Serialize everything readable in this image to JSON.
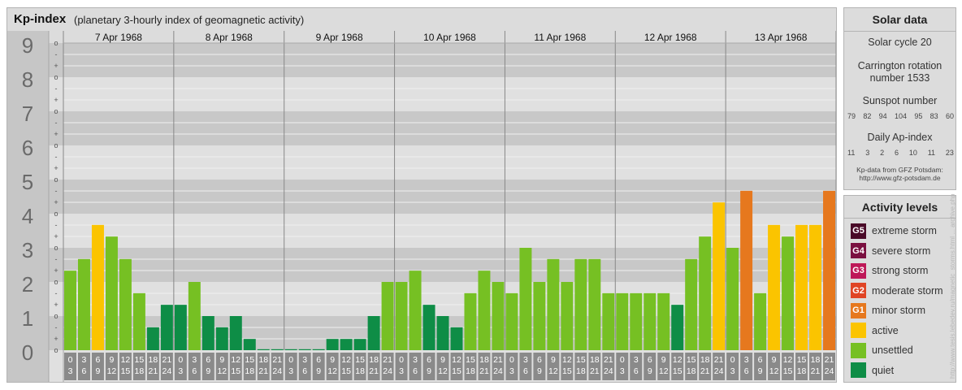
{
  "title": {
    "main": "Kp-index",
    "sub": "(planetary 3-hourly index of geomagnetic activity)"
  },
  "colors": {
    "quiet": "#0e8d46",
    "unsettled": "#76c023",
    "active": "#fbc400",
    "minor_storm": "#e6781e",
    "moderate_storm": "#e04424",
    "strong_storm": "#be1858",
    "severe_storm": "#7a1040",
    "extreme_storm": "#4a0a28"
  },
  "chart_data": {
    "type": "bar",
    "title": "Kp-index",
    "subtitle": "(planetary 3-hourly index of geomagnetic activity)",
    "y_axis_labels": [
      "0",
      "1",
      "2",
      "3",
      "4",
      "5",
      "6",
      "7",
      "8",
      "9"
    ],
    "y_minor_labels": [
      "o",
      "+",
      "-"
    ],
    "ylim": [
      0,
      9
    ],
    "days": [
      "7 Apr 1968",
      "8 Apr 1968",
      "9 Apr 1968",
      "10 Apr 1968",
      "11 Apr 1968",
      "12 Apr 1968",
      "13 Apr 1968"
    ],
    "interval_top": [
      "0",
      "3",
      "6",
      "9",
      "12",
      "15",
      "18",
      "21"
    ],
    "interval_bottom": [
      "3",
      "6",
      "9",
      "12",
      "15",
      "18",
      "21",
      "24"
    ],
    "values": [
      2.33,
      2.67,
      3.67,
      3.33,
      2.67,
      1.67,
      0.67,
      1.33,
      1.33,
      2.0,
      1.0,
      0.67,
      1.0,
      0.33,
      0.0,
      0.0,
      0.0,
      0.0,
      0.0,
      0.33,
      0.33,
      0.33,
      1.0,
      2.0,
      2.0,
      2.33,
      1.33,
      1.0,
      0.67,
      1.67,
      2.33,
      2.0,
      1.67,
      3.0,
      2.0,
      2.67,
      2.0,
      2.67,
      2.67,
      1.67,
      1.67,
      1.67,
      1.67,
      1.67,
      1.33,
      2.67,
      3.33,
      4.33,
      3.0,
      4.67,
      1.67,
      3.67,
      3.33,
      3.67,
      3.67,
      4.67
    ]
  },
  "solar": {
    "title": "Solar data",
    "cycle": "Solar cycle 20",
    "carrington_l1": "Carrington rotation",
    "carrington_l2": "number 1533",
    "sunspot_title": "Sunspot number",
    "sunspots": [
      "79",
      "82",
      "94",
      "104",
      "95",
      "83",
      "60"
    ],
    "ap_title": "Daily Ap-index",
    "ap": [
      "11",
      "3",
      "2",
      "6",
      "10",
      "11",
      "23"
    ],
    "source_l1": "Kp-data from GFZ Potsdam:",
    "source_l2": "http://www.gfz-potsdam.de"
  },
  "activity": {
    "title": "Activity levels",
    "items": [
      {
        "code": "G5",
        "label": "extreme storm",
        "color": "#4a0a28"
      },
      {
        "code": "G4",
        "label": "severe storm",
        "color": "#7a1040"
      },
      {
        "code": "G3",
        "label": "strong storm",
        "color": "#be1858"
      },
      {
        "code": "G2",
        "label": "moderate storm",
        "color": "#e04424"
      },
      {
        "code": "G1",
        "label": "minor storm",
        "color": "#e6781e"
      },
      {
        "code": "",
        "label": "active",
        "color": "#fbc400"
      },
      {
        "code": "",
        "label": "unsettled",
        "color": "#76c023"
      },
      {
        "code": "",
        "label": "quiet",
        "color": "#0e8d46"
      }
    ]
  },
  "watermark": "http://www.tesis.lebedev.ru/magnetic_storms.html ... archive.php"
}
